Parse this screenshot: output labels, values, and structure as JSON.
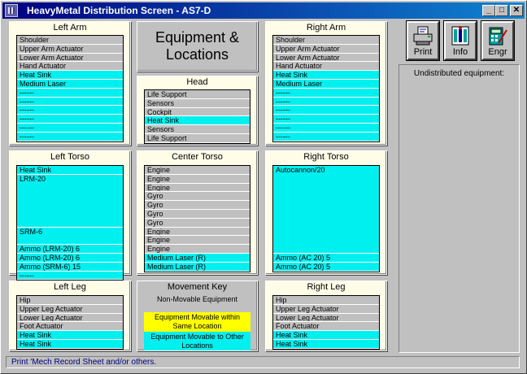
{
  "window": {
    "title": "HeavyMetal Distribution Screen - AS7-D",
    "minimize_glyph": "_",
    "maximize_glyph": "□",
    "close_glyph": "✕"
  },
  "equipment_title": [
    "Equipment &",
    "Locations"
  ],
  "toolbar": {
    "print_label": "Print",
    "info_label": "Info",
    "engr_label": "Engr"
  },
  "undistributed": {
    "title": "Undistributed equipment:"
  },
  "status_text": "Print 'Mech Record Sheet and/or others.",
  "movement_key": {
    "title": "Movement Key",
    "non_movable": "Non-Movable Equipment",
    "movable_same": "Equipment Movable within Same Location",
    "movable_other": "Equipment Movable to Other Locations",
    "colors": {
      "non_movable": "#c0c0c0",
      "movable_same": "#ffff00",
      "movable_other": "#00f0f0"
    }
  },
  "locations": {
    "left_arm": {
      "title": "Left Arm",
      "slots": [
        {
          "label": "Shoulder",
          "kind": "nm"
        },
        {
          "label": "Upper Arm Actuator",
          "kind": "nm"
        },
        {
          "label": "Lower Arm Actuator",
          "kind": "nm"
        },
        {
          "label": "Hand Actuator",
          "kind": "nm"
        },
        {
          "label": "Heat Sink",
          "kind": "mv"
        },
        {
          "label": "Medium Laser",
          "kind": "mv"
        },
        {
          "label": "------",
          "kind": "mv"
        },
        {
          "label": "------",
          "kind": "mv"
        },
        {
          "label": "------",
          "kind": "mv"
        },
        {
          "label": "------",
          "kind": "mv"
        },
        {
          "label": "------",
          "kind": "mv"
        },
        {
          "label": "------",
          "kind": "mv"
        }
      ]
    },
    "right_arm": {
      "title": "Right Arm",
      "slots": [
        {
          "label": "Shoulder",
          "kind": "nm"
        },
        {
          "label": "Upper Arm Actuator",
          "kind": "nm"
        },
        {
          "label": "Lower Arm Actuator",
          "kind": "nm"
        },
        {
          "label": "Hand Actuator",
          "kind": "nm"
        },
        {
          "label": "Heat Sink",
          "kind": "mv"
        },
        {
          "label": "Medium Laser",
          "kind": "mv"
        },
        {
          "label": "------",
          "kind": "mv"
        },
        {
          "label": "------",
          "kind": "mv"
        },
        {
          "label": "------",
          "kind": "mv"
        },
        {
          "label": "------",
          "kind": "mv"
        },
        {
          "label": "------",
          "kind": "mv"
        },
        {
          "label": "------",
          "kind": "mv"
        }
      ]
    },
    "head": {
      "title": "Head",
      "slots": [
        {
          "label": "Life Support",
          "kind": "nm"
        },
        {
          "label": "Sensors",
          "kind": "nm"
        },
        {
          "label": "Cockpit",
          "kind": "nm"
        },
        {
          "label": "Heat Sink",
          "kind": "mv"
        },
        {
          "label": "Sensors",
          "kind": "nm"
        },
        {
          "label": "Life Support",
          "kind": "nm"
        }
      ]
    },
    "left_torso": {
      "title": "Left Torso",
      "slots": [
        {
          "label": "Heat Sink",
          "kind": "mv"
        },
        {
          "label": "LRM-20",
          "kind": "mv",
          "rows": 6
        },
        {
          "label": "SRM-6",
          "kind": "mv",
          "rows": 2
        },
        {
          "label": "Ammo (LRM-20) 6",
          "kind": "mv"
        },
        {
          "label": "Ammo (LRM-20) 6",
          "kind": "mv"
        },
        {
          "label": "Ammo (SRM-6) 15",
          "kind": "mv"
        },
        {
          "label": "------",
          "kind": "mv"
        }
      ]
    },
    "center_torso": {
      "title": "Center Torso",
      "slots": [
        {
          "label": "Engine",
          "kind": "nm"
        },
        {
          "label": "Engine",
          "kind": "nm"
        },
        {
          "label": "Engine",
          "kind": "nm"
        },
        {
          "label": "Gyro",
          "kind": "nm"
        },
        {
          "label": "Gyro",
          "kind": "nm"
        },
        {
          "label": "Gyro",
          "kind": "nm"
        },
        {
          "label": "Gyro",
          "kind": "nm"
        },
        {
          "label": "Engine",
          "kind": "nm"
        },
        {
          "label": "Engine",
          "kind": "nm"
        },
        {
          "label": "Engine",
          "kind": "nm"
        },
        {
          "label": "Medium Laser (R)",
          "kind": "mv"
        },
        {
          "label": "Medium Laser (R)",
          "kind": "mv"
        }
      ]
    },
    "right_torso": {
      "title": "Right Torso",
      "slots": [
        {
          "label": "Autocannon/20",
          "kind": "mv",
          "rows": 10
        },
        {
          "label": "Ammo (AC 20) 5",
          "kind": "mv"
        },
        {
          "label": "Ammo (AC 20) 5",
          "kind": "mv"
        }
      ]
    },
    "left_leg": {
      "title": "Left Leg",
      "slots": [
        {
          "label": "Hip",
          "kind": "nm"
        },
        {
          "label": "Upper Leg Actuator",
          "kind": "nm"
        },
        {
          "label": "Lower Leg Actuator",
          "kind": "nm"
        },
        {
          "label": "Foot Actuator",
          "kind": "nm"
        },
        {
          "label": "Heat Sink",
          "kind": "mv"
        },
        {
          "label": "Heat Sink",
          "kind": "mv"
        }
      ]
    },
    "right_leg": {
      "title": "Right Leg",
      "slots": [
        {
          "label": "Hip",
          "kind": "nm"
        },
        {
          "label": "Upper Leg Actuator",
          "kind": "nm"
        },
        {
          "label": "Lower Leg Actuator",
          "kind": "nm"
        },
        {
          "label": "Foot Actuator",
          "kind": "nm"
        },
        {
          "label": "Heat Sink",
          "kind": "mv"
        },
        {
          "label": "Heat Sink",
          "kind": "mv"
        }
      ]
    }
  }
}
